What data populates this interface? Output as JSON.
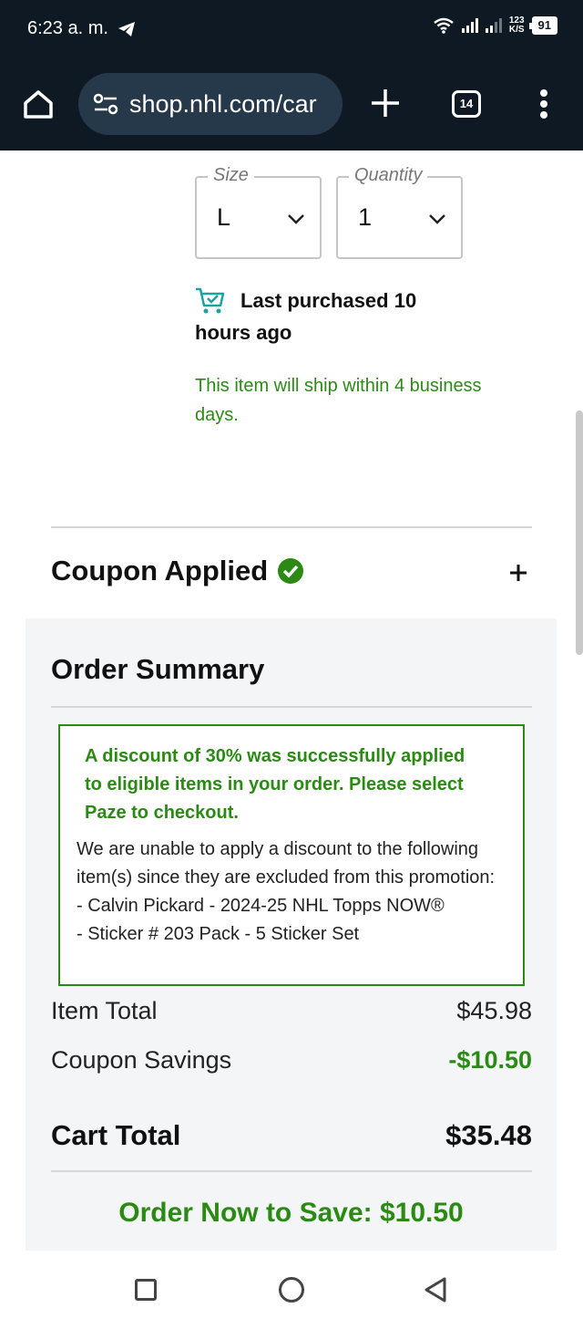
{
  "status_bar": {
    "time": "6:23 a. m.",
    "speed_top": "123",
    "speed_bottom": "K/S",
    "battery": "91"
  },
  "browser": {
    "url": "shop.nhl.com/car",
    "tab_count": "14"
  },
  "product": {
    "size_label": "Size",
    "size_value": "L",
    "quantity_label": "Quantity",
    "quantity_value": "1",
    "last_purchased": "Last purchased 10 hours ago",
    "shipping_note": "This item will ship within 4 business days."
  },
  "coupon": {
    "title": "Coupon Applied"
  },
  "order_summary": {
    "title": "Order Summary",
    "promo_success": "A discount of 30% was successfully applied to eligible items in your order. Please select Paze to checkout.",
    "promo_exclusion": "We are unable to apply a discount to the following item(s) since they are excluded from this promotion:",
    "excluded_items": [
      "- Calvin Pickard - 2024-25 NHL Topps NOW®",
      "- Sticker # 203 Pack - 5 Sticker Set"
    ],
    "item_total_label": "Item Total",
    "item_total_value": "$45.98",
    "coupon_savings_label": "Coupon Savings",
    "coupon_savings_value": "-$10.50",
    "cart_total_label": "Cart Total",
    "cart_total_value": "$35.48",
    "cta": "Order Now to Save: $10.50"
  },
  "colors": {
    "chrome_bg": "#0f1923",
    "url_pill": "#26394a",
    "accent_green": "#2a8a14",
    "cart_icon": "#1aa3a3",
    "summary_bg": "#f4f5f6"
  }
}
